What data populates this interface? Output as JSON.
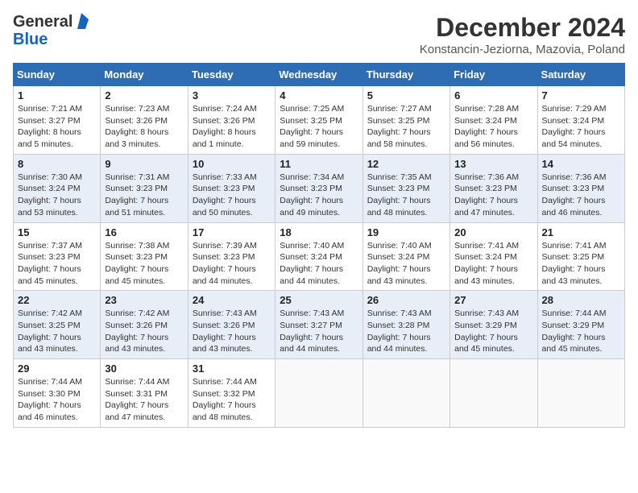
{
  "logo": {
    "general": "General",
    "blue": "Blue"
  },
  "header": {
    "month": "December 2024",
    "location": "Konstancin-Jeziorna, Mazovia, Poland"
  },
  "weekdays": [
    "Sunday",
    "Monday",
    "Tuesday",
    "Wednesday",
    "Thursday",
    "Friday",
    "Saturday"
  ],
  "weeks": [
    [
      {
        "day": "1",
        "info": "Sunrise: 7:21 AM\nSunset: 3:27 PM\nDaylight: 8 hours\nand 5 minutes."
      },
      {
        "day": "2",
        "info": "Sunrise: 7:23 AM\nSunset: 3:26 PM\nDaylight: 8 hours\nand 3 minutes."
      },
      {
        "day": "3",
        "info": "Sunrise: 7:24 AM\nSunset: 3:26 PM\nDaylight: 8 hours\nand 1 minute."
      },
      {
        "day": "4",
        "info": "Sunrise: 7:25 AM\nSunset: 3:25 PM\nDaylight: 7 hours\nand 59 minutes."
      },
      {
        "day": "5",
        "info": "Sunrise: 7:27 AM\nSunset: 3:25 PM\nDaylight: 7 hours\nand 58 minutes."
      },
      {
        "day": "6",
        "info": "Sunrise: 7:28 AM\nSunset: 3:24 PM\nDaylight: 7 hours\nand 56 minutes."
      },
      {
        "day": "7",
        "info": "Sunrise: 7:29 AM\nSunset: 3:24 PM\nDaylight: 7 hours\nand 54 minutes."
      }
    ],
    [
      {
        "day": "8",
        "info": "Sunrise: 7:30 AM\nSunset: 3:24 PM\nDaylight: 7 hours\nand 53 minutes."
      },
      {
        "day": "9",
        "info": "Sunrise: 7:31 AM\nSunset: 3:23 PM\nDaylight: 7 hours\nand 51 minutes."
      },
      {
        "day": "10",
        "info": "Sunrise: 7:33 AM\nSunset: 3:23 PM\nDaylight: 7 hours\nand 50 minutes."
      },
      {
        "day": "11",
        "info": "Sunrise: 7:34 AM\nSunset: 3:23 PM\nDaylight: 7 hours\nand 49 minutes."
      },
      {
        "day": "12",
        "info": "Sunrise: 7:35 AM\nSunset: 3:23 PM\nDaylight: 7 hours\nand 48 minutes."
      },
      {
        "day": "13",
        "info": "Sunrise: 7:36 AM\nSunset: 3:23 PM\nDaylight: 7 hours\nand 47 minutes."
      },
      {
        "day": "14",
        "info": "Sunrise: 7:36 AM\nSunset: 3:23 PM\nDaylight: 7 hours\nand 46 minutes."
      }
    ],
    [
      {
        "day": "15",
        "info": "Sunrise: 7:37 AM\nSunset: 3:23 PM\nDaylight: 7 hours\nand 45 minutes."
      },
      {
        "day": "16",
        "info": "Sunrise: 7:38 AM\nSunset: 3:23 PM\nDaylight: 7 hours\nand 45 minutes."
      },
      {
        "day": "17",
        "info": "Sunrise: 7:39 AM\nSunset: 3:23 PM\nDaylight: 7 hours\nand 44 minutes."
      },
      {
        "day": "18",
        "info": "Sunrise: 7:40 AM\nSunset: 3:24 PM\nDaylight: 7 hours\nand 44 minutes."
      },
      {
        "day": "19",
        "info": "Sunrise: 7:40 AM\nSunset: 3:24 PM\nDaylight: 7 hours\nand 43 minutes."
      },
      {
        "day": "20",
        "info": "Sunrise: 7:41 AM\nSunset: 3:24 PM\nDaylight: 7 hours\nand 43 minutes."
      },
      {
        "day": "21",
        "info": "Sunrise: 7:41 AM\nSunset: 3:25 PM\nDaylight: 7 hours\nand 43 minutes."
      }
    ],
    [
      {
        "day": "22",
        "info": "Sunrise: 7:42 AM\nSunset: 3:25 PM\nDaylight: 7 hours\nand 43 minutes."
      },
      {
        "day": "23",
        "info": "Sunrise: 7:42 AM\nSunset: 3:26 PM\nDaylight: 7 hours\nand 43 minutes."
      },
      {
        "day": "24",
        "info": "Sunrise: 7:43 AM\nSunset: 3:26 PM\nDaylight: 7 hours\nand 43 minutes."
      },
      {
        "day": "25",
        "info": "Sunrise: 7:43 AM\nSunset: 3:27 PM\nDaylight: 7 hours\nand 44 minutes."
      },
      {
        "day": "26",
        "info": "Sunrise: 7:43 AM\nSunset: 3:28 PM\nDaylight: 7 hours\nand 44 minutes."
      },
      {
        "day": "27",
        "info": "Sunrise: 7:43 AM\nSunset: 3:29 PM\nDaylight: 7 hours\nand 45 minutes."
      },
      {
        "day": "28",
        "info": "Sunrise: 7:44 AM\nSunset: 3:29 PM\nDaylight: 7 hours\nand 45 minutes."
      }
    ],
    [
      {
        "day": "29",
        "info": "Sunrise: 7:44 AM\nSunset: 3:30 PM\nDaylight: 7 hours\nand 46 minutes."
      },
      {
        "day": "30",
        "info": "Sunrise: 7:44 AM\nSunset: 3:31 PM\nDaylight: 7 hours\nand 47 minutes."
      },
      {
        "day": "31",
        "info": "Sunrise: 7:44 AM\nSunset: 3:32 PM\nDaylight: 7 hours\nand 48 minutes."
      },
      {
        "day": "",
        "info": ""
      },
      {
        "day": "",
        "info": ""
      },
      {
        "day": "",
        "info": ""
      },
      {
        "day": "",
        "info": ""
      }
    ]
  ]
}
